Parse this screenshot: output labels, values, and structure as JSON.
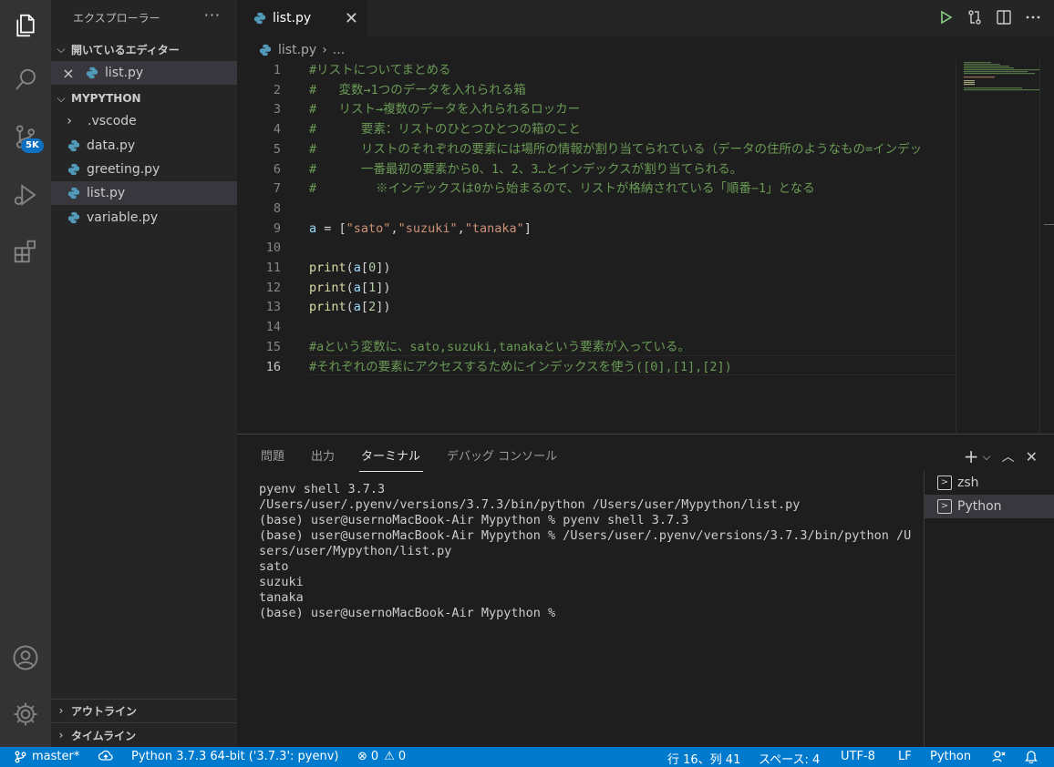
{
  "activity": {
    "scm_badge": "5K"
  },
  "sidebar": {
    "title": "エクスプローラー",
    "more": "···",
    "open_editors": {
      "label": "開いているエディター",
      "file": "list.py",
      "close": "×"
    },
    "project": {
      "label": "MYPYTHON",
      "items": [
        {
          "label": ".vscode",
          "kind": "folder"
        },
        {
          "label": "data.py",
          "kind": "py"
        },
        {
          "label": "greeting.py",
          "kind": "py"
        },
        {
          "label": "list.py",
          "kind": "py",
          "active": true
        },
        {
          "label": "variable.py",
          "kind": "py"
        }
      ]
    },
    "outline": "アウトライン",
    "timeline": "タイムライン"
  },
  "tab": {
    "label": "list.py",
    "close": "✕"
  },
  "breadcrumb": {
    "file": "list.py",
    "sep": "›",
    "rest": "..."
  },
  "editor": {
    "current_line": 16,
    "lines": [
      {
        "n": "1",
        "text": "#リストについてまとめる"
      },
      {
        "n": "2",
        "text": "#   変数→1つのデータを入れられる箱"
      },
      {
        "n": "3",
        "text": "#   リスト→複数のデータを入れられるロッカー"
      },
      {
        "n": "4",
        "text": "#      要素：リストのひとつひとつの箱のこと"
      },
      {
        "n": "5",
        "text": "#      リストのそれぞれの要素には場所の情報が割り当てられている（データの住所のようなもの=インデッ"
      },
      {
        "n": "6",
        "text": "#      一番最初の要素から0、1、2、3…とインデックスが割り当てられる。"
      },
      {
        "n": "7",
        "text": "#        ※インデックスは0から始まるので、リストが格納されている「順番−1」となる"
      },
      {
        "n": "8",
        "text": ""
      },
      {
        "n": "9",
        "text": "a = [\"sato\",\"suzuki\",\"tanaka\"]"
      },
      {
        "n": "10",
        "text": ""
      },
      {
        "n": "11",
        "text": "print(a[0])"
      },
      {
        "n": "12",
        "text": "print(a[1])"
      },
      {
        "n": "13",
        "text": "print(a[2])"
      },
      {
        "n": "14",
        "text": ""
      },
      {
        "n": "15",
        "text": "#aという変数に、sato,suzuki,tanakaという要素が入っている。"
      },
      {
        "n": "16",
        "text": "#それぞれの要素にアクセスするためにインデックスを使う([0],[1],[2])"
      }
    ]
  },
  "panel": {
    "tabs": [
      "問題",
      "出力",
      "ターミナル",
      "デバッグ コンソール"
    ],
    "active_tab": "ターミナル",
    "terminal_lines": [
      "pyenv shell 3.7.3",
      "/Users/user/.pyenv/versions/3.7.3/bin/python /Users/user/Mypython/list.py",
      "(base) user@usernoMacBook-Air Mypython % pyenv shell 3.7.3",
      "(base) user@usernoMacBook-Air Mypython % /Users/user/.pyenv/versions/3.7.3/bin/python /U",
      "sers/user/Mypython/list.py",
      "sato",
      "suzuki",
      "tanaka",
      "(base) user@usernoMacBook-Air Mypython % "
    ],
    "terminals": [
      "zsh",
      "Python"
    ],
    "active_terminal": "Python"
  },
  "status": {
    "branch": "master*",
    "interpreter": "Python 3.7.3 64-bit ('3.7.3': pyenv)",
    "errors": "0",
    "warnings": "0",
    "position": "行 16、列 41",
    "spaces": "スペース: 4",
    "encoding": "UTF-8",
    "eol": "LF",
    "language": "Python"
  },
  "colors": {
    "accent": "#007acc",
    "comment": "#6a9955",
    "string": "#ce9178",
    "function": "#dcdcaa",
    "variable": "#9cdcfe",
    "number": "#b5cea8"
  }
}
